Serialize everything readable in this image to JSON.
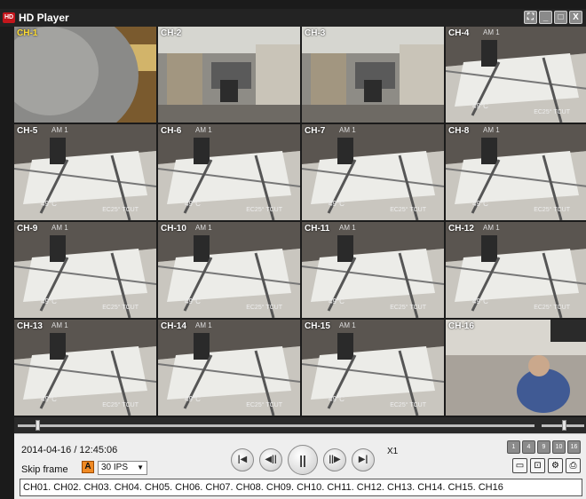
{
  "window": {
    "title": "HD Player",
    "app_icon_text": "HD"
  },
  "window_buttons": [
    "⛶",
    "_",
    "□",
    "X"
  ],
  "channels": [
    {
      "label": "CH-1",
      "osd_top": "",
      "osd_temp": "",
      "osd_temp2": "",
      "selected": true,
      "scene": "closeup"
    },
    {
      "label": "CH-2",
      "osd_top": "",
      "osd_temp": "",
      "osd_temp2": "",
      "selected": false,
      "scene": "office"
    },
    {
      "label": "CH-3",
      "osd_top": "",
      "osd_temp": "",
      "osd_temp2": "",
      "selected": false,
      "scene": "office2"
    },
    {
      "label": "CH-4",
      "osd_top": "AM 1",
      "osd_temp": "49°C",
      "osd_temp2": "EC25° TCUT",
      "selected": false,
      "scene": "lobby"
    },
    {
      "label": "CH-5",
      "osd_top": "AM 1",
      "osd_temp": "49°C",
      "osd_temp2": "EC25° TCUT",
      "selected": false,
      "scene": "lobby"
    },
    {
      "label": "CH-6",
      "osd_top": "AM 1",
      "osd_temp": "49°C",
      "osd_temp2": "EC25° TCUT",
      "selected": false,
      "scene": "lobby"
    },
    {
      "label": "CH-7",
      "osd_top": "AM 1",
      "osd_temp": "49°C",
      "osd_temp2": "EC25° TCUT",
      "selected": false,
      "scene": "lobby"
    },
    {
      "label": "CH-8",
      "osd_top": "AM 1",
      "osd_temp": "49°C",
      "osd_temp2": "EC25° TCUT",
      "selected": false,
      "scene": "lobby"
    },
    {
      "label": "CH-9",
      "osd_top": "AM 1",
      "osd_temp": "49°C",
      "osd_temp2": "EC25° TCUT",
      "selected": false,
      "scene": "lobby"
    },
    {
      "label": "CH-10",
      "osd_top": "AM 1",
      "osd_temp": "49°C",
      "osd_temp2": "EC25° TCUT",
      "selected": false,
      "scene": "lobby"
    },
    {
      "label": "CH-11",
      "osd_top": "AM 1",
      "osd_temp": "49°C",
      "osd_temp2": "EC25° TCUT",
      "selected": false,
      "scene": "lobby"
    },
    {
      "label": "CH-12",
      "osd_top": "AM 1",
      "osd_temp": "49°C",
      "osd_temp2": "EC25° TCUT",
      "selected": false,
      "scene": "lobby"
    },
    {
      "label": "CH-13",
      "osd_top": "AM 1",
      "osd_temp": "49°C",
      "osd_temp2": "EC25° TCUT",
      "selected": false,
      "scene": "lobby"
    },
    {
      "label": "CH-14",
      "osd_top": "AM 1",
      "osd_temp": "49°C",
      "osd_temp2": "EC25° TCUT",
      "selected": false,
      "scene": "lobby"
    },
    {
      "label": "CH-15",
      "osd_top": "AM 1",
      "osd_temp": "49°C",
      "osd_temp2": "EC25° TCUT",
      "selected": false,
      "scene": "lobby"
    },
    {
      "label": "CH-16",
      "osd_top": "",
      "osd_temp": "",
      "osd_temp2": "",
      "selected": false,
      "scene": "desk"
    }
  ],
  "playback": {
    "datetime": "2014-04-16 / 12:45:06",
    "skip_frame_label": "Skip frame",
    "skip_icon": "A",
    "ips_value": "30 IPS",
    "speed": "X1",
    "buttons": {
      "first": "|◀",
      "step_back": "◀||",
      "pause": "||",
      "step_fwd": "||▶",
      "last": "▶|"
    },
    "timeline_position": 0.035,
    "volume_position": 0.55
  },
  "layout_buttons": [
    "1",
    "4",
    "9",
    "10",
    "16"
  ],
  "tool_buttons": [
    {
      "name": "display-icon",
      "glyph": "▭"
    },
    {
      "name": "folder-icon",
      "glyph": "⊡"
    },
    {
      "name": "settings-icon",
      "glyph": "⚙"
    },
    {
      "name": "print-icon",
      "glyph": "⎙"
    }
  ],
  "channel_list": "CH01. CH02. CH03. CH04. CH05. CH06. CH07. CH08. CH09. CH10. CH11. CH12. CH13. CH14. CH15. CH16",
  "colors": {
    "selected_border": "#d41f1f",
    "selected_label": "#ffde33",
    "accent": "#f08a24"
  }
}
